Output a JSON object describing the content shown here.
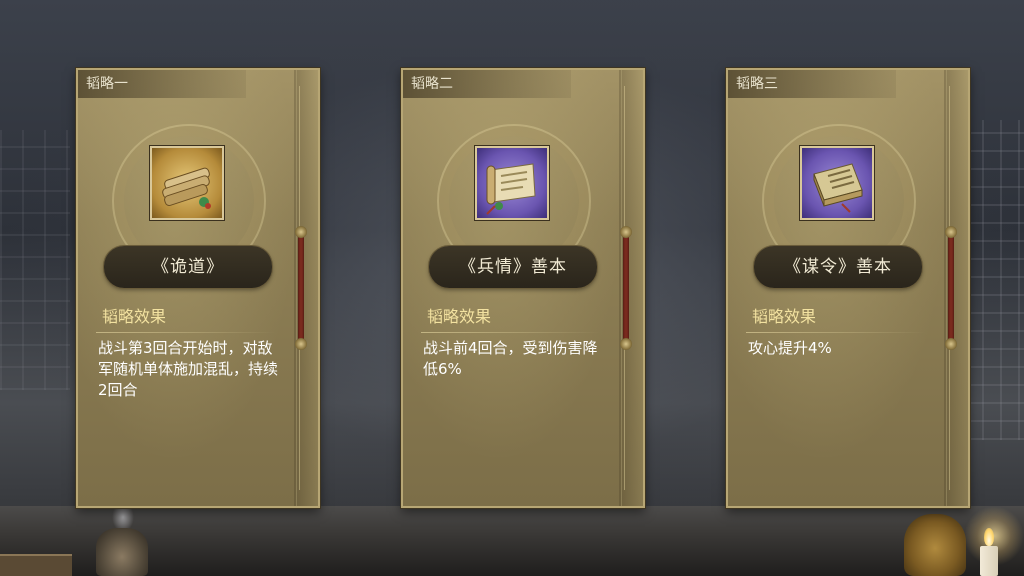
{
  "cards": [
    {
      "tab": "韬略一",
      "item_name": "《诡道》",
      "item_icon": "scroll-bundle-icon",
      "item_rarity_color": "#c79b4a",
      "effect_title": "韬略效果",
      "effect_text": "战斗第3回合开始时，对敌军随机单体施加混乱，持续2回合"
    },
    {
      "tab": "韬略二",
      "item_name": "《兵情》善本",
      "item_icon": "open-scroll-icon",
      "item_rarity_color": "#6a55b0",
      "effect_title": "韬略效果",
      "effect_text": "战斗前4回合，受到伤害降低6%"
    },
    {
      "tab": "韬略三",
      "item_name": "《谋令》善本",
      "item_icon": "bound-book-icon",
      "item_rarity_color": "#6a55b0",
      "effect_title": "韬略效果",
      "effect_text": "攻心提升4%"
    }
  ]
}
